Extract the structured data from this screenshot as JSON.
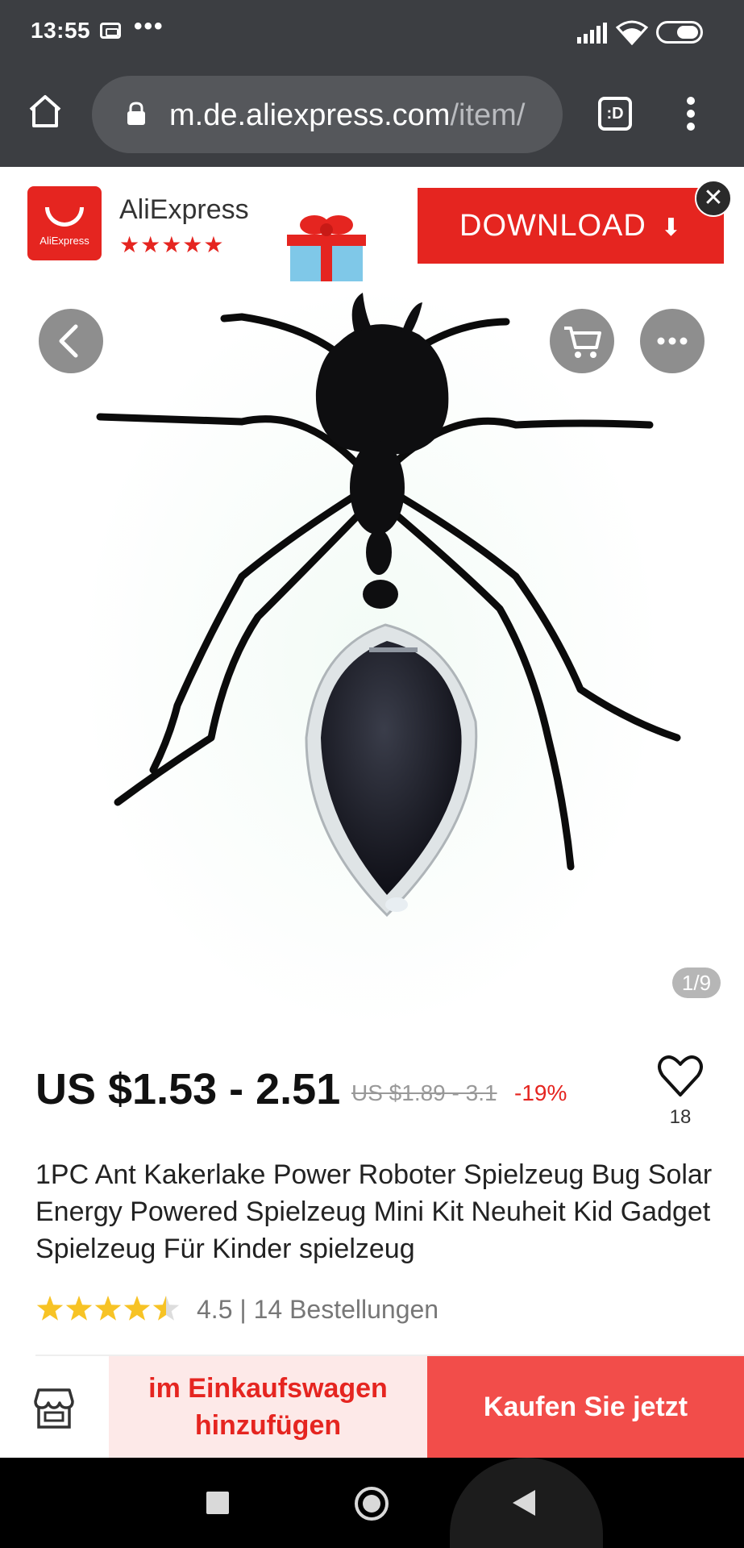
{
  "status_bar": {
    "time": "13:55",
    "dots": "•••"
  },
  "browser": {
    "url_host": "m.de.aliexpress.com",
    "url_path": "/item/",
    "tabs_label": ":D"
  },
  "banner": {
    "app_name": "AliExpress",
    "app_logo_text": "AliExpress",
    "app_stars": "★★★★★",
    "download_label": "DOWNLOAD",
    "download_arrow": "⬇",
    "close_glyph": "✕"
  },
  "gallery": {
    "page_indicator": "1/9"
  },
  "product": {
    "price": "US $1.53 - 2.51",
    "original_price": "US $1.89 - 3.1",
    "discount": "-19%",
    "wishlist_count": "18",
    "title": "1PC Ant Kakerlake Power Roboter Spielzeug Bug Solar Energy Powered Spielzeug Mini Kit Neuheit Kid Gadget Spielzeug Für Kinder spielzeug",
    "rating": 4.5,
    "rating_text": "4.5 | 14 Bestellungen"
  },
  "actions": {
    "add_to_cart": "im Einkaufswagen hinzufügen",
    "buy_now": "Kaufen Sie jetzt"
  },
  "colors": {
    "accent": "#e52520",
    "buy_button": "#f24d4a",
    "cart_button_bg": "#fde9e8",
    "star": "#f7c325",
    "chrome": "#3c3e42"
  },
  "icons": {
    "home": "home-icon",
    "lock": "lock-icon",
    "tabs": "tabs-icon",
    "menu": "more-vert-icon",
    "back": "chevron-left-icon",
    "cart": "cart-icon",
    "more": "more-horiz-icon",
    "wishlist": "heart-icon",
    "store": "store-icon"
  }
}
